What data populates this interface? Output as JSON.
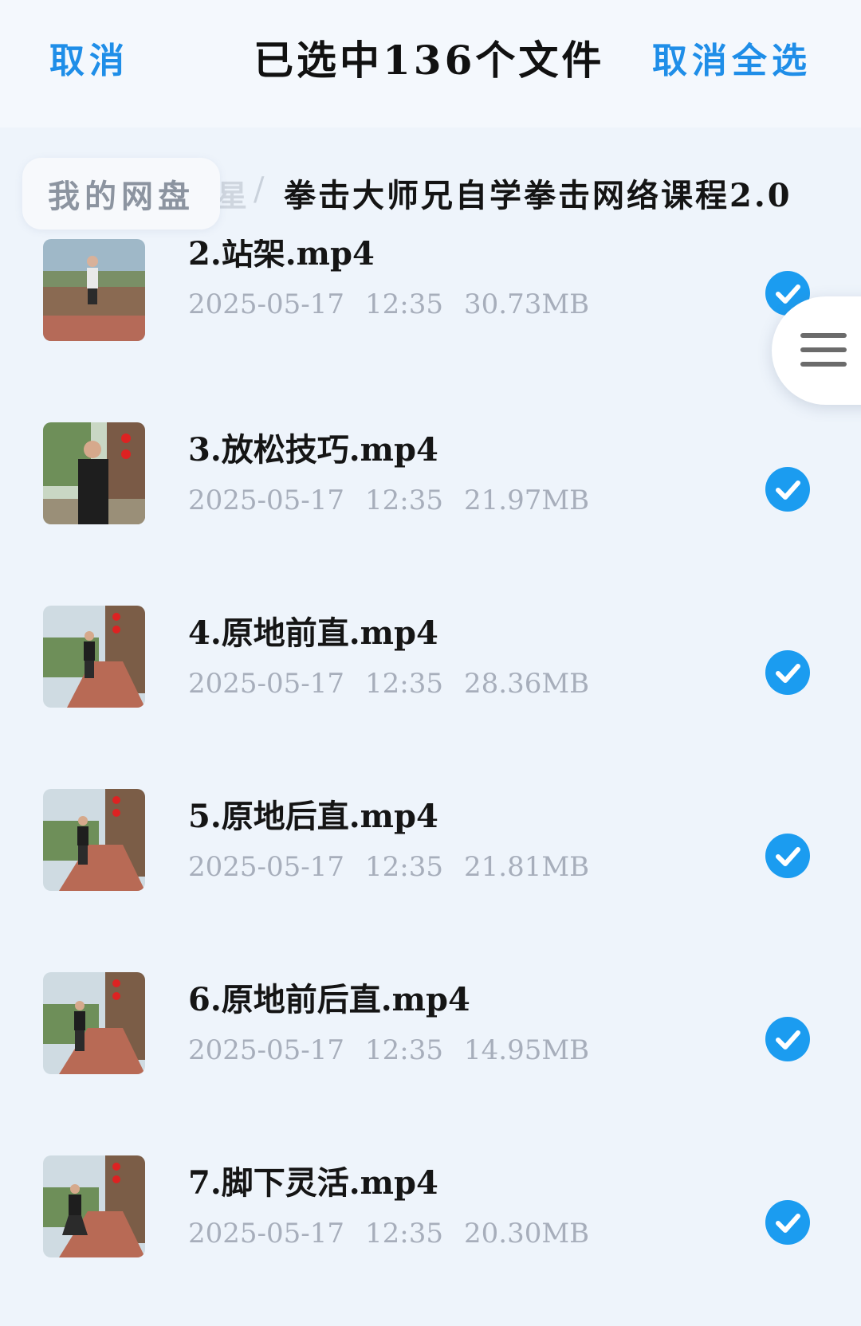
{
  "header": {
    "cancel_label": "取消",
    "title": "已选中136个文件",
    "deselect_all_label": "取消全选"
  },
  "breadcrumb": {
    "root_label": "我的网盘",
    "ghost_fragment": "星",
    "separator": "/",
    "current_folder": "拳击大师兄自学拳击网络课程2.0"
  },
  "files": [
    {
      "name": "2.站架.mp4",
      "date": "2025-05-17",
      "time": "12:35",
      "size": "30.73MB",
      "selected": true
    },
    {
      "name": "3.放松技巧.mp4",
      "date": "2025-05-17",
      "time": "12:35",
      "size": "21.97MB",
      "selected": true
    },
    {
      "name": "4.原地前直.mp4",
      "date": "2025-05-17",
      "time": "12:35",
      "size": "28.36MB",
      "selected": true
    },
    {
      "name": "5.原地后直.mp4",
      "date": "2025-05-17",
      "time": "12:35",
      "size": "21.81MB",
      "selected": true
    },
    {
      "name": "6.原地前后直.mp4",
      "date": "2025-05-17",
      "time": "12:35",
      "size": "14.95MB",
      "selected": true
    },
    {
      "name": "7.脚下灵活.mp4",
      "date": "2025-05-17",
      "time": "12:35",
      "size": "20.30MB",
      "selected": true
    }
  ],
  "icons": {
    "check": "check-circle-icon",
    "menu": "hamburger-menu-icon"
  },
  "colors": {
    "accent": "#1f8ee8",
    "check": "#1b9cf0",
    "background": "#eef4fb"
  }
}
